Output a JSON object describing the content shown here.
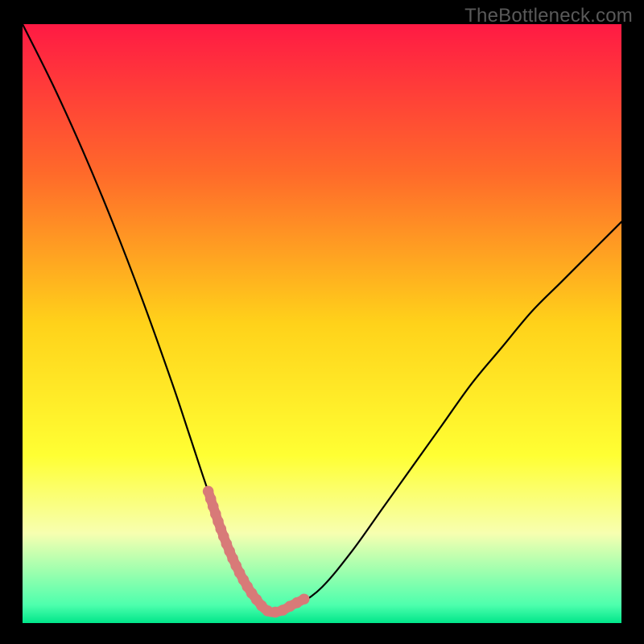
{
  "watermark": "TheBottleneck.com",
  "chart_data": {
    "type": "line",
    "title": "",
    "xlabel": "",
    "ylabel": "",
    "xlim": [
      0,
      100
    ],
    "ylim": [
      0,
      100
    ],
    "grid": false,
    "legend": false,
    "background_gradient": {
      "stops": [
        {
          "pos": 0.0,
          "color": "#ff1a44"
        },
        {
          "pos": 0.25,
          "color": "#ff6a2a"
        },
        {
          "pos": 0.5,
          "color": "#ffd21a"
        },
        {
          "pos": 0.72,
          "color": "#ffff33"
        },
        {
          "pos": 0.85,
          "color": "#f7ffb0"
        },
        {
          "pos": 0.97,
          "color": "#4dffad"
        },
        {
          "pos": 1.0,
          "color": "#00e68a"
        }
      ]
    },
    "series": [
      {
        "name": "curve",
        "color": "#000000",
        "x": [
          0,
          5,
          10,
          15,
          20,
          25,
          28,
          31,
          34,
          36,
          38,
          40,
          42,
          44,
          46,
          50,
          55,
          60,
          65,
          70,
          75,
          80,
          85,
          90,
          95,
          100
        ],
        "y": [
          100,
          90,
          79,
          67,
          54,
          40,
          31,
          22,
          14,
          9,
          5,
          3,
          2,
          2,
          3,
          6,
          12,
          19,
          26,
          33,
          40,
          46,
          52,
          57,
          62,
          67
        ]
      },
      {
        "name": "highlight-segment",
        "color": "#d87a78",
        "x": [
          31,
          33,
          35,
          37,
          39,
          41,
          43,
          45,
          47
        ],
        "y": [
          22,
          16,
          11,
          7,
          4,
          2,
          2,
          3,
          4
        ]
      }
    ],
    "annotations": []
  }
}
